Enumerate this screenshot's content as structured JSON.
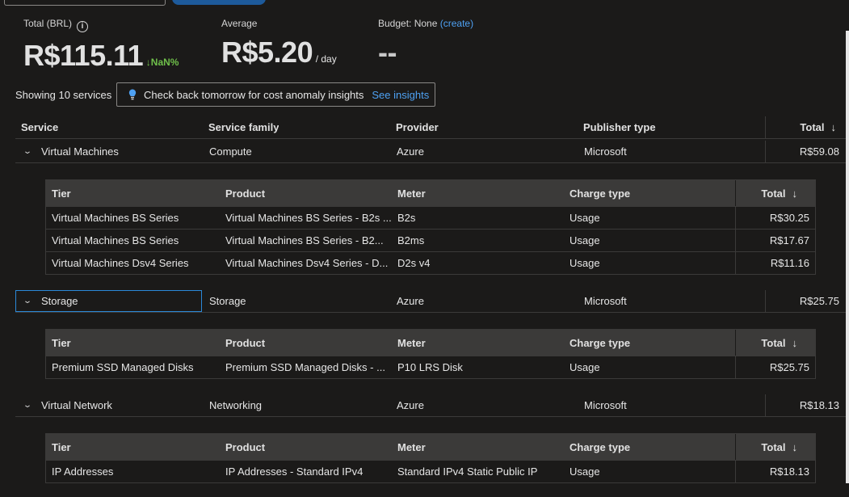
{
  "kpis": {
    "total_label": "Total (BRL)",
    "total_value": "R$115.11",
    "total_trend": "NaN%",
    "average_label": "Average",
    "average_value": "R$5.20",
    "average_unit": "/ day",
    "budget_label": "Budget: None",
    "budget_link": "(create)",
    "budget_value": "--"
  },
  "toolbar": {
    "showing": "Showing 10 services",
    "insight_text": "Check back tomorrow for cost anomaly insights",
    "insight_link": "See insights"
  },
  "table": {
    "headers": [
      "Service",
      "Service family",
      "Provider",
      "Publisher type",
      "Total"
    ],
    "sort_arrow": "↓",
    "groups": [
      {
        "service": "Virtual Machines",
        "family": "Compute",
        "provider": "Azure",
        "publisher": "Microsoft",
        "total": "R$59.08",
        "sub_headers": [
          "Tier",
          "Product",
          "Meter",
          "Charge type",
          "Total"
        ],
        "rows": [
          {
            "tier": "Virtual Machines BS Series",
            "product": "Virtual Machines BS Series - B2s ...",
            "meter": "B2s",
            "charge": "Usage",
            "total": "R$30.25"
          },
          {
            "tier": "Virtual Machines BS Series",
            "product": "Virtual Machines BS Series - B2...",
            "meter": "B2ms",
            "charge": "Usage",
            "total": "R$17.67"
          },
          {
            "tier": "Virtual Machines Dsv4 Series",
            "product": "Virtual Machines Dsv4 Series - D...",
            "meter": "D2s v4",
            "charge": "Usage",
            "total": "R$11.16"
          }
        ]
      },
      {
        "service": "Storage",
        "family": "Storage",
        "provider": "Azure",
        "publisher": "Microsoft",
        "total": "R$25.75",
        "sub_headers": [
          "Tier",
          "Product",
          "Meter",
          "Charge type",
          "Total"
        ],
        "rows": [
          {
            "tier": "Premium SSD Managed Disks",
            "product": "Premium SSD Managed Disks - ...",
            "meter": "P10 LRS Disk",
            "charge": "Usage",
            "total": "R$25.75"
          }
        ]
      },
      {
        "service": "Virtual Network",
        "family": "Networking",
        "provider": "Azure",
        "publisher": "Microsoft",
        "total": "R$18.13",
        "sub_headers": [
          "Tier",
          "Product",
          "Meter",
          "Charge type",
          "Total"
        ],
        "rows": [
          {
            "tier": "IP Addresses",
            "product": "IP Addresses - Standard IPv4",
            "meter": "Standard IPv4 Static Public IP",
            "charge": "Usage",
            "total": "R$18.13"
          }
        ]
      }
    ]
  },
  "colors": {
    "background": "#1b1a19",
    "accent": "#4ea1f3",
    "trend": "#6fbf4a",
    "focus": "#2b88d8"
  },
  "icons": {
    "info": "info-icon",
    "insight": "lightbulb-icon",
    "expand": "chevron-down-icon",
    "sort": "arrow-down-icon"
  }
}
